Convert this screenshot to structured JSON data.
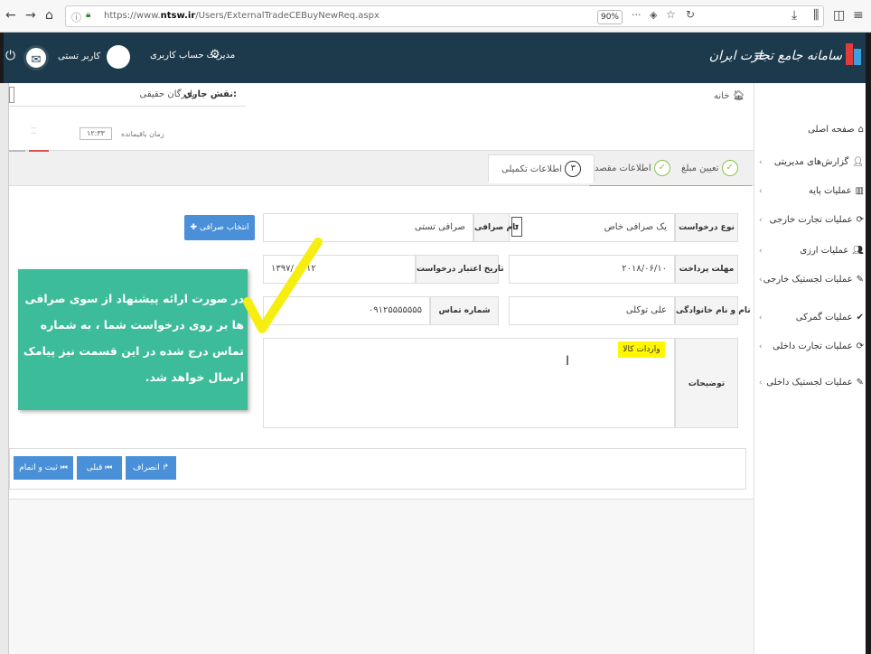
{
  "browser": {
    "url_prefix": "https://www.",
    "url_domain": "ntsw.ir",
    "url_path": "/Users/ExternalTradeCEBuyNewReq.aspx",
    "zoom": "90%"
  },
  "header": {
    "brand": "سامانه جامع تجارت ایران",
    "user_name": "کاربر تستی",
    "account_mgmt": "مدیریت حساب کاربری"
  },
  "breadcrumb": "خانه",
  "role": {
    "label": "نقش جاری:",
    "value": "بازرگان حقیقی"
  },
  "session": {
    "label": "زمان باقیمانده",
    "time": "۱۲:۳۳"
  },
  "sidebar": {
    "items": [
      {
        "label": "صفحه اصلی",
        "icon": "home-icon"
      },
      {
        "label": "گزارش‌های مدیریتی",
        "icon": "user-icon"
      },
      {
        "label": "عملیات پایه",
        "icon": "chart-icon"
      },
      {
        "label": "عملیات تجارت خارجی",
        "icon": "sync-icon"
      },
      {
        "label": "عملیات ارزی",
        "icon": "users-icon"
      },
      {
        "label": "عملیات لجستیک خارجی",
        "icon": "edit-icon"
      },
      {
        "label": "عملیات گمرکی",
        "icon": "check-icon"
      },
      {
        "label": "عملیات تجارت داخلی",
        "icon": "sync-icon"
      },
      {
        "label": "عملیات لجستیک داخلی",
        "icon": "edit-icon"
      }
    ]
  },
  "wizard": {
    "steps": [
      {
        "label": "تعیین مبلغ",
        "marker": "✓"
      },
      {
        "label": "اطلاعات مقصد",
        "marker": "✓"
      },
      {
        "label": "اطلاعات تکمیلی",
        "marker": "۳"
      }
    ]
  },
  "form": {
    "request_type_label": "نوع درخواست",
    "request_type_value": "یک صرافی خاص",
    "exchange_name_label": "نام صرافی",
    "exchange_name_value": "صرافی تستی",
    "pick_exchange_button": "انتخاب صرافی",
    "payment_deadline_label": "مهلت پرداخت",
    "payment_deadline_value": "۲۰۱۸/۰۶/۱۰",
    "validity_date_label": "تاریخ اعتبار درخواست",
    "validity_date_value": "۱۳۹۷/۰۳/۱۲",
    "fullname_label": "نام و نام خانوادگی",
    "fullname_value": "علی توکلی",
    "phone_label": "شماره تماس",
    "phone_value": "۰۹۱۲۵۵۵۵۵۵۵",
    "description_label": "توضیحات",
    "description_value": "واردات کالا"
  },
  "callout": {
    "text": "در صورت ارائه پیشنهاد از سوی صرافی ها بر روی درخواست شما ، به شماره تماس درج شده در این قسمت نیز پیامک ارسال خواهد شد."
  },
  "nav": {
    "cancel": "انصراف",
    "previous": "قبلی",
    "submit": "ثبت و اتمام"
  },
  "colors": {
    "header_bg": "#1c3a4c",
    "callout_bg": "#3dbc9a",
    "button_blue": "#4a90d9",
    "highlight_yellow": "#fff600",
    "step_green": "#8bc34a"
  }
}
